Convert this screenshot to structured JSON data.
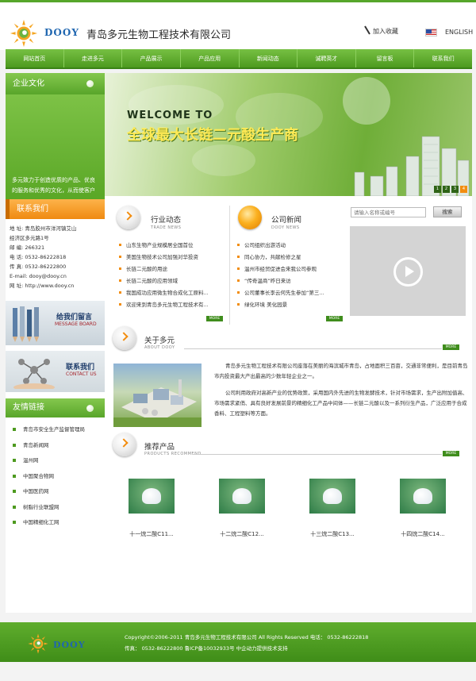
{
  "header": {
    "brand_text": "DOOY",
    "company_name": "青岛多元生物工程技术有限公司",
    "favorite_label": "加入收藏",
    "english_label": "ENGLISH"
  },
  "nav": {
    "items": [
      "网站首页",
      "走进多元",
      "产品展示",
      "产品应用",
      "新闻动态",
      "诚聘英才",
      "留言板",
      "联系我们"
    ]
  },
  "sidebar": {
    "culture_title": "企业文化",
    "culture_text": "多元致力于创造优质的产品、优良的服务和优秀的文化，从而使客户和员工能共享高品位",
    "contact_title": "联系我们",
    "contact_lines": [
      "地 址: 青岛胶州市洋河镇艾山",
      "经济区多元路1号",
      "邮 编: 266321",
      "电 话: 0532-86222818",
      "传 真: 0532-86222800",
      "E-mail: dooy@dooy.cn",
      "网 址: http://www.dooy.cn"
    ],
    "message_banner": {
      "title": "给我们留言",
      "subtitle": "MESSAGE BOARD"
    },
    "contact_banner": {
      "title": "联系我们",
      "subtitle": "CONTACT US"
    },
    "links_title": "友情链接",
    "links": [
      "青岛市安全生产监督管理局",
      "青岛新闻网",
      "温州网",
      "中国聚合物网",
      "中国医药网",
      "树脂行业联盟网",
      "中国精细化工网"
    ]
  },
  "hero": {
    "welcome": "WELCOME TO",
    "slogan": "全球最大长链二元酸生产商",
    "pager": [
      "1",
      "2",
      "3",
      "4"
    ]
  },
  "trade_news": {
    "title": "行业动态",
    "subtitle": "TRADE NEWS",
    "items": [
      "山东生物产业规模居全国首位",
      "美国生物技术公司加强对华投资",
      "长链二元酸的用途",
      "长链二元酸的应用领域",
      "我国成功应用微生物合成化工原料...",
      "欢迎来到青岛多元生物工程技术有..."
    ],
    "more": "MORE"
  },
  "company_news": {
    "title": "公司新闻",
    "subtitle": "DOOY NEWS",
    "items": [
      "公司组织出游活动",
      "同心协力，共献检修之星",
      "温州市经贸促进会来我公司参观",
      "“传奇温商”昨日来访",
      "公司董事长李云何先生参加“第三...",
      "绿化环境 美化园景"
    ],
    "more": "MORE"
  },
  "search": {
    "placeholder": "请输入名称或编号",
    "button": "搜索"
  },
  "about": {
    "title": "关于多元",
    "subtitle": "ABOUT DOOY",
    "more": "MORE",
    "paragraphs": [
      "青岛多元生物工程技术有限公司座落在美丽的海滨城市青岛，占地面积三百亩，交通非常便利，是目前青岛市内投资最大产出最高的少数年轻企业之一。",
      "公司利用政府对高新产业的优势政策，采用国内外先进的生物发酵技术，针对市场需求，生产出附加值高、市场需求紧俏、具有良好发展前景的精细化工产品中间体——长链二元酸以及一系列衍生产品，广泛应用于合成香料、工程塑料等方面。"
    ]
  },
  "products": {
    "title": "推荐产品",
    "subtitle": "PRODUCTS RECOMMEND",
    "more": "MORE",
    "items": [
      "十一烷二酸C11...",
      "十二烷二酸C12...",
      "十三烷二酸C13...",
      "十四烷二酸C14..."
    ]
  },
  "footer": {
    "brand_text": "DOOY",
    "line1": "Copyright©2006-2011 青岛多元生物工程技术有限公司  All Rights Reserved 电话： 0532-86222818",
    "line2": "传真： 0532-86222800   鲁ICP备10032933号  中企动力提供技术支持"
  },
  "colors": {
    "brand_green": "#57a62b",
    "accent_orange": "#f28d10",
    "brand_blue": "#1f66b0"
  }
}
